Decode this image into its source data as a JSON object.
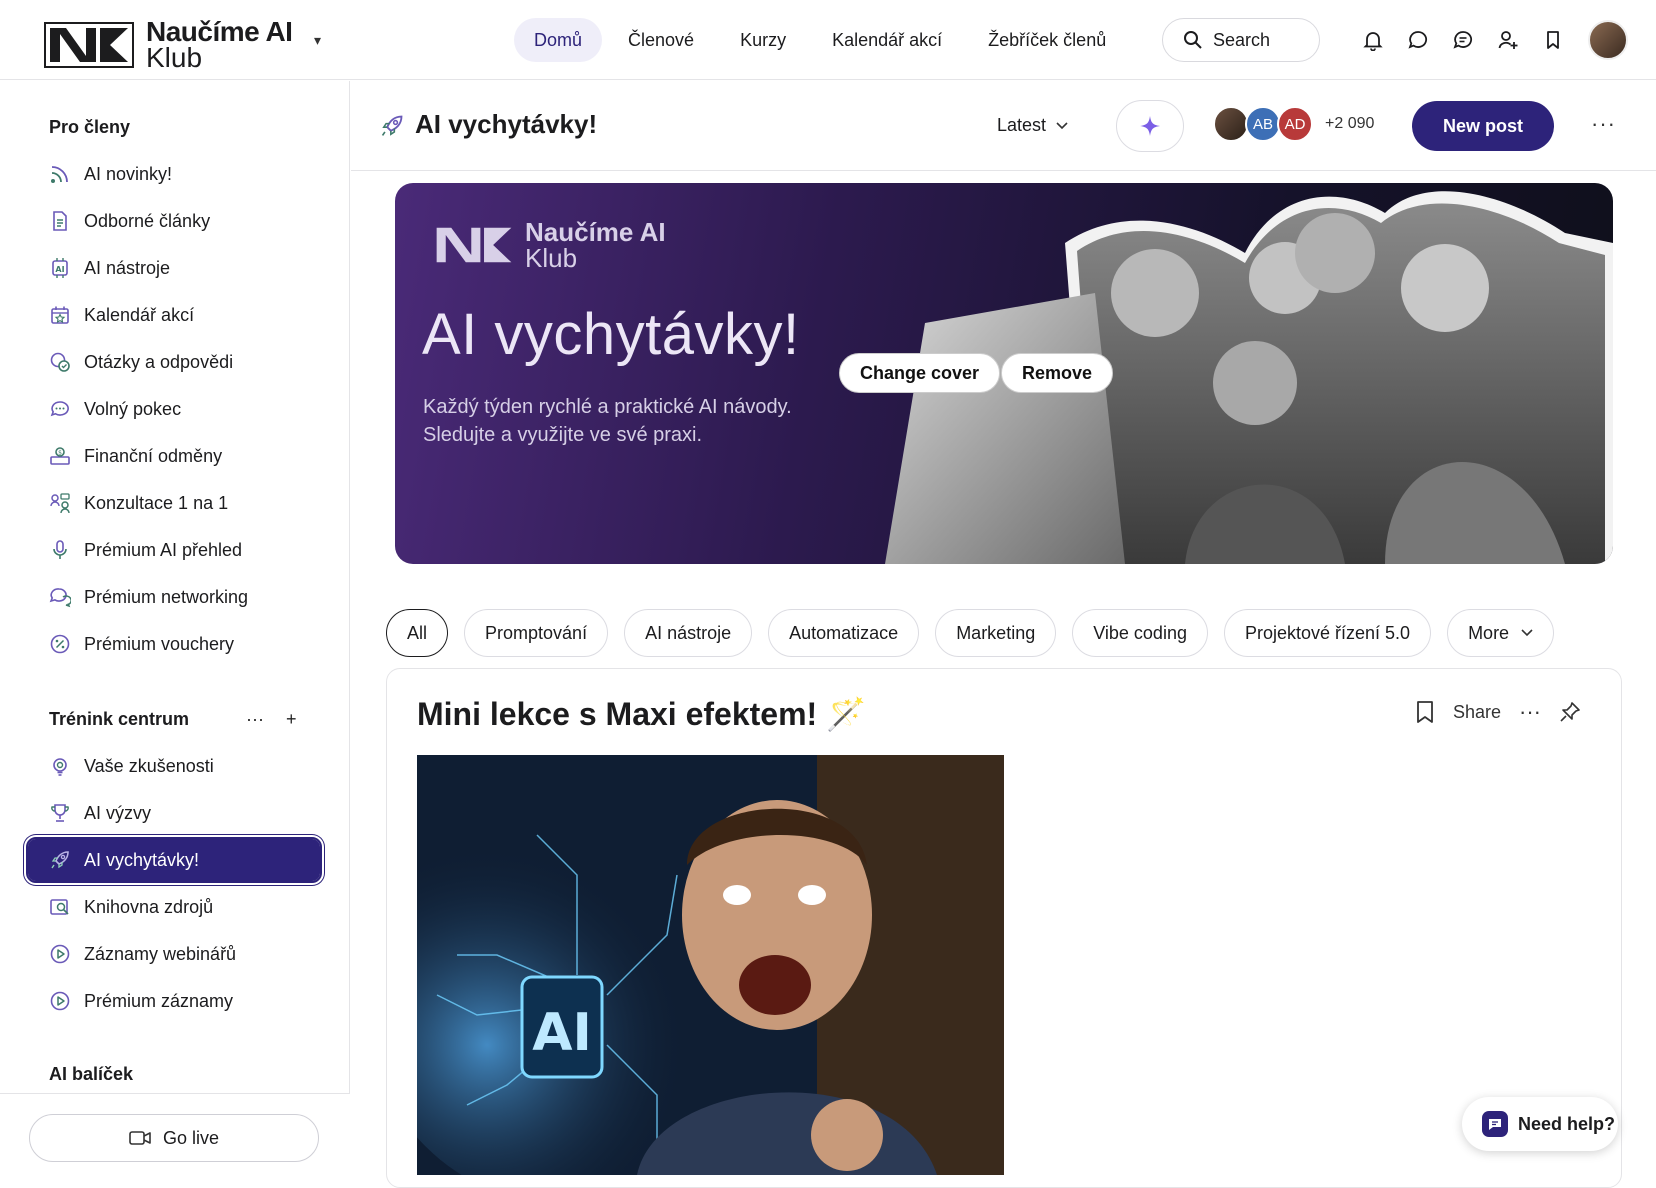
{
  "brand": {
    "line1": "Naučíme AI",
    "line2": "Klub"
  },
  "nav": [
    "Domů",
    "Členové",
    "Kurzy",
    "Kalendář akcí",
    "Žebříček členů"
  ],
  "search": {
    "label": "Search"
  },
  "sidebar": {
    "section1": "Pro členy",
    "items1": [
      "AI novinky!",
      "Odborné články",
      "AI nástroje",
      "Kalendář akcí",
      "Otázky a odpovědi",
      "Volný pokec",
      "Finanční odměny",
      "Konzultace 1 na 1",
      "Prémium AI přehled",
      "Prémium networking",
      "Prémium vouchery"
    ],
    "section2": "Trénink centrum",
    "section2_more": "···",
    "section2_add": "+",
    "items2": [
      "Vaše zkušenosti",
      "AI výzvy",
      "AI vychytávky!",
      "Knihovna zdrojů",
      "Záznamy webinářů",
      "Prémium záznamy"
    ],
    "section3": "AI balíček",
    "golive": "Go live"
  },
  "header": {
    "title": "AI vychytávky!",
    "sort": "Latest",
    "member_initials": [
      "AB",
      "AD"
    ],
    "member_count": "+2 090",
    "new_post": "New post",
    "more": "···"
  },
  "cover": {
    "logo_line1": "Naučíme AI",
    "logo_line2": "Klub",
    "title": "AI vychytávky!",
    "subtitle_line1": "Každý týden rychlé a praktické AI návody.",
    "subtitle_line2": "Sledujte a využijte ve své praxi.",
    "change_cover": "Change cover",
    "remove": "Remove"
  },
  "filters": [
    "All",
    "Promptování",
    "AI nástroje",
    "Automatizace",
    "Marketing",
    "Vibe coding",
    "Projektové řízení 5.0",
    "More"
  ],
  "post": {
    "title": "Mini lekce s Maxi efektem! 🪄",
    "share": "Share",
    "more": "···",
    "image_text": "AI"
  },
  "help": {
    "label": "Need help?"
  },
  "colors": {
    "accent": "#2d237a",
    "nav_active_bg": "#efeef9",
    "icon_green": "#3e7a6a"
  }
}
